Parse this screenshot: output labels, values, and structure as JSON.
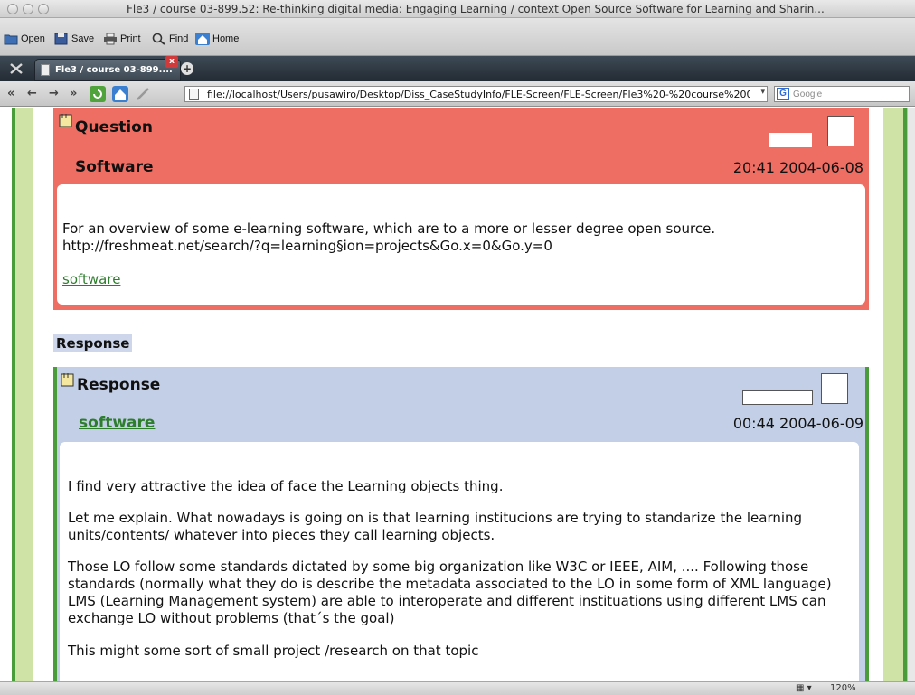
{
  "window": {
    "title": "Fle3 / course 03-899.52: Re-thinking digital media: Engaging Learning / context Open Source Software for Learning and Sharin..."
  },
  "toolbar": {
    "open_label": "Open",
    "save_label": "Save",
    "print_label": "Print",
    "find_label": "Find",
    "home_label": "Home"
  },
  "tabs": [
    {
      "label": "Fle3 / course 03-899...."
    }
  ],
  "tab_close": "x",
  "new_tab": "+",
  "nav": {
    "back": "«",
    "back2": "←",
    "forward": "→",
    "forward2": "»"
  },
  "address": {
    "url": "file://localhost/Users/pusawiro/Desktop/Diss_CaseStudyInfo/FLE-Screen/FLE-Screen/Fle3%20-%20course%2003-899_"
  },
  "search": {
    "engine_icon": "G",
    "placeholder": "Google"
  },
  "question": {
    "heading": "Question",
    "title": "Software",
    "date": "20:41 2004-06-08",
    "body": "For an overview of some e-learning software, which are to a more or lesser degree open source. http://freshmeat.net/search/?q=learning§ion=projects&Go.x=0&Go.y=0",
    "link": "software",
    "color": "#ee6e64"
  },
  "response_label": "Response",
  "response": {
    "heading": "Response",
    "title": "software",
    "date": "00:44 2004-06-09",
    "paragraphs": [
      "I find very attractive the idea of face the Learning objects thing.",
      "Let me explain. What nowadays is going on is that learning institucions are trying to standarize the learning units/contents/ whatever into pieces they call learning objects.",
      "Those LO follow some standards dictated by some big organization like W3C or IEEE, AIM, .... Following those standards (normally what they do is describe the metadata associated to the LO in some form of XML language) LMS (Learning Management system) are able to interoperate and different instituations using different LMS can exchange LO without problems (that´s the goal)",
      "This might some sort of small project /research on that topic"
    ],
    "color": "#c2cfe6"
  },
  "status": {
    "zoom": "120%"
  }
}
